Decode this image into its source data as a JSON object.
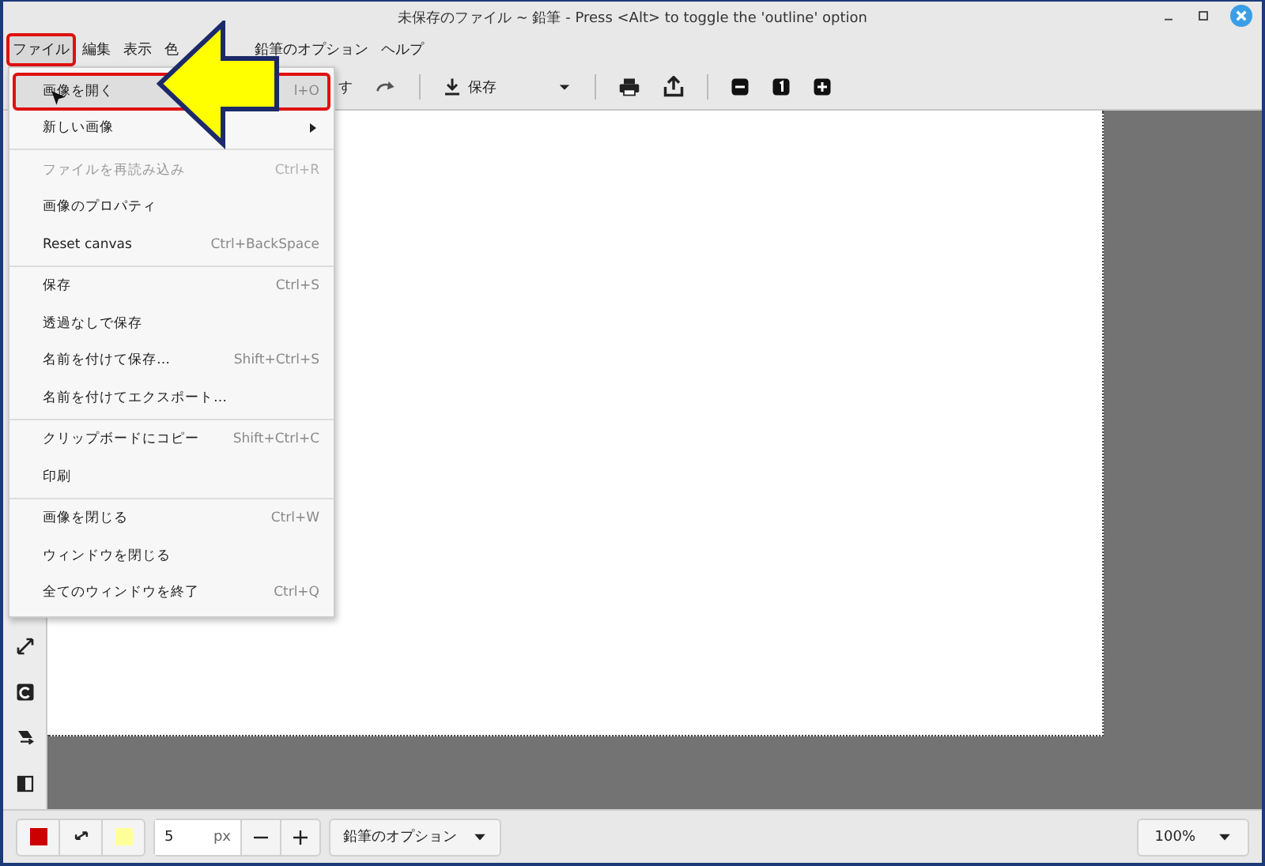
{
  "window": {
    "title": "未保存のファイル ~ 鉛筆 - Press <Alt> to toggle the 'outline' option"
  },
  "menubar": [
    {
      "label": "ファイル",
      "selected": true,
      "highlighted": true
    },
    {
      "label": "編集",
      "selected": false,
      "highlighted": false
    },
    {
      "label": "表示",
      "selected": false,
      "highlighted": false
    },
    {
      "label": "色",
      "selected": false,
      "highlighted": false
    },
    {
      "label": "鉛筆のオプション",
      "selected": false,
      "highlighted": false
    },
    {
      "label": "ヘルプ",
      "selected": false,
      "highlighted": false
    }
  ],
  "toolbar": {
    "undo_label": "す",
    "save_label": "保存"
  },
  "file_menu": [
    [
      {
        "label": "画像を開く",
        "shortcut": "l+O",
        "selected": true,
        "highlighted": true,
        "disabled": false
      },
      {
        "label": "新しい画像",
        "submenu": true,
        "selected": false,
        "highlighted": false,
        "disabled": false
      }
    ],
    [
      {
        "label": "ファイルを再読み込み",
        "shortcut": "Ctrl+R",
        "selected": false,
        "highlighted": false,
        "disabled": true
      },
      {
        "label": "画像のプロパティ",
        "selected": false,
        "highlighted": false,
        "disabled": false
      },
      {
        "label": "Reset canvas",
        "shortcut": "Ctrl+BackSpace",
        "selected": false,
        "highlighted": false,
        "disabled": false
      }
    ],
    [
      {
        "label": "保存",
        "shortcut": "Ctrl+S",
        "selected": false,
        "highlighted": false,
        "disabled": false
      },
      {
        "label": "透過なしで保存",
        "selected": false,
        "highlighted": false,
        "disabled": false
      },
      {
        "label": "名前を付けて保存…",
        "shortcut": "Shift+Ctrl+S",
        "selected": false,
        "highlighted": false,
        "disabled": false
      },
      {
        "label": "名前を付けてエクスポート…",
        "selected": false,
        "highlighted": false,
        "disabled": false
      }
    ],
    [
      {
        "label": "クリップボードにコピー",
        "shortcut": "Shift+Ctrl+C",
        "selected": false,
        "highlighted": false,
        "disabled": false
      },
      {
        "label": "印刷",
        "selected": false,
        "highlighted": false,
        "disabled": false
      }
    ],
    [
      {
        "label": "画像を閉じる",
        "shortcut": "Ctrl+W",
        "selected": false,
        "highlighted": false,
        "disabled": false
      },
      {
        "label": "ウィンドウを閉じる",
        "selected": false,
        "highlighted": false,
        "disabled": false
      },
      {
        "label": "全てのウィンドウを終了",
        "shortcut": "Ctrl+Q",
        "selected": false,
        "highlighted": false,
        "disabled": false
      }
    ]
  ],
  "bottom_bar": {
    "colors": [
      {
        "color": "#cc0000"
      },
      {
        "color": "#ffff99"
      }
    ],
    "size": "5",
    "unit": "px",
    "options_label": "鉛筆のオプション",
    "zoom": "100%"
  }
}
